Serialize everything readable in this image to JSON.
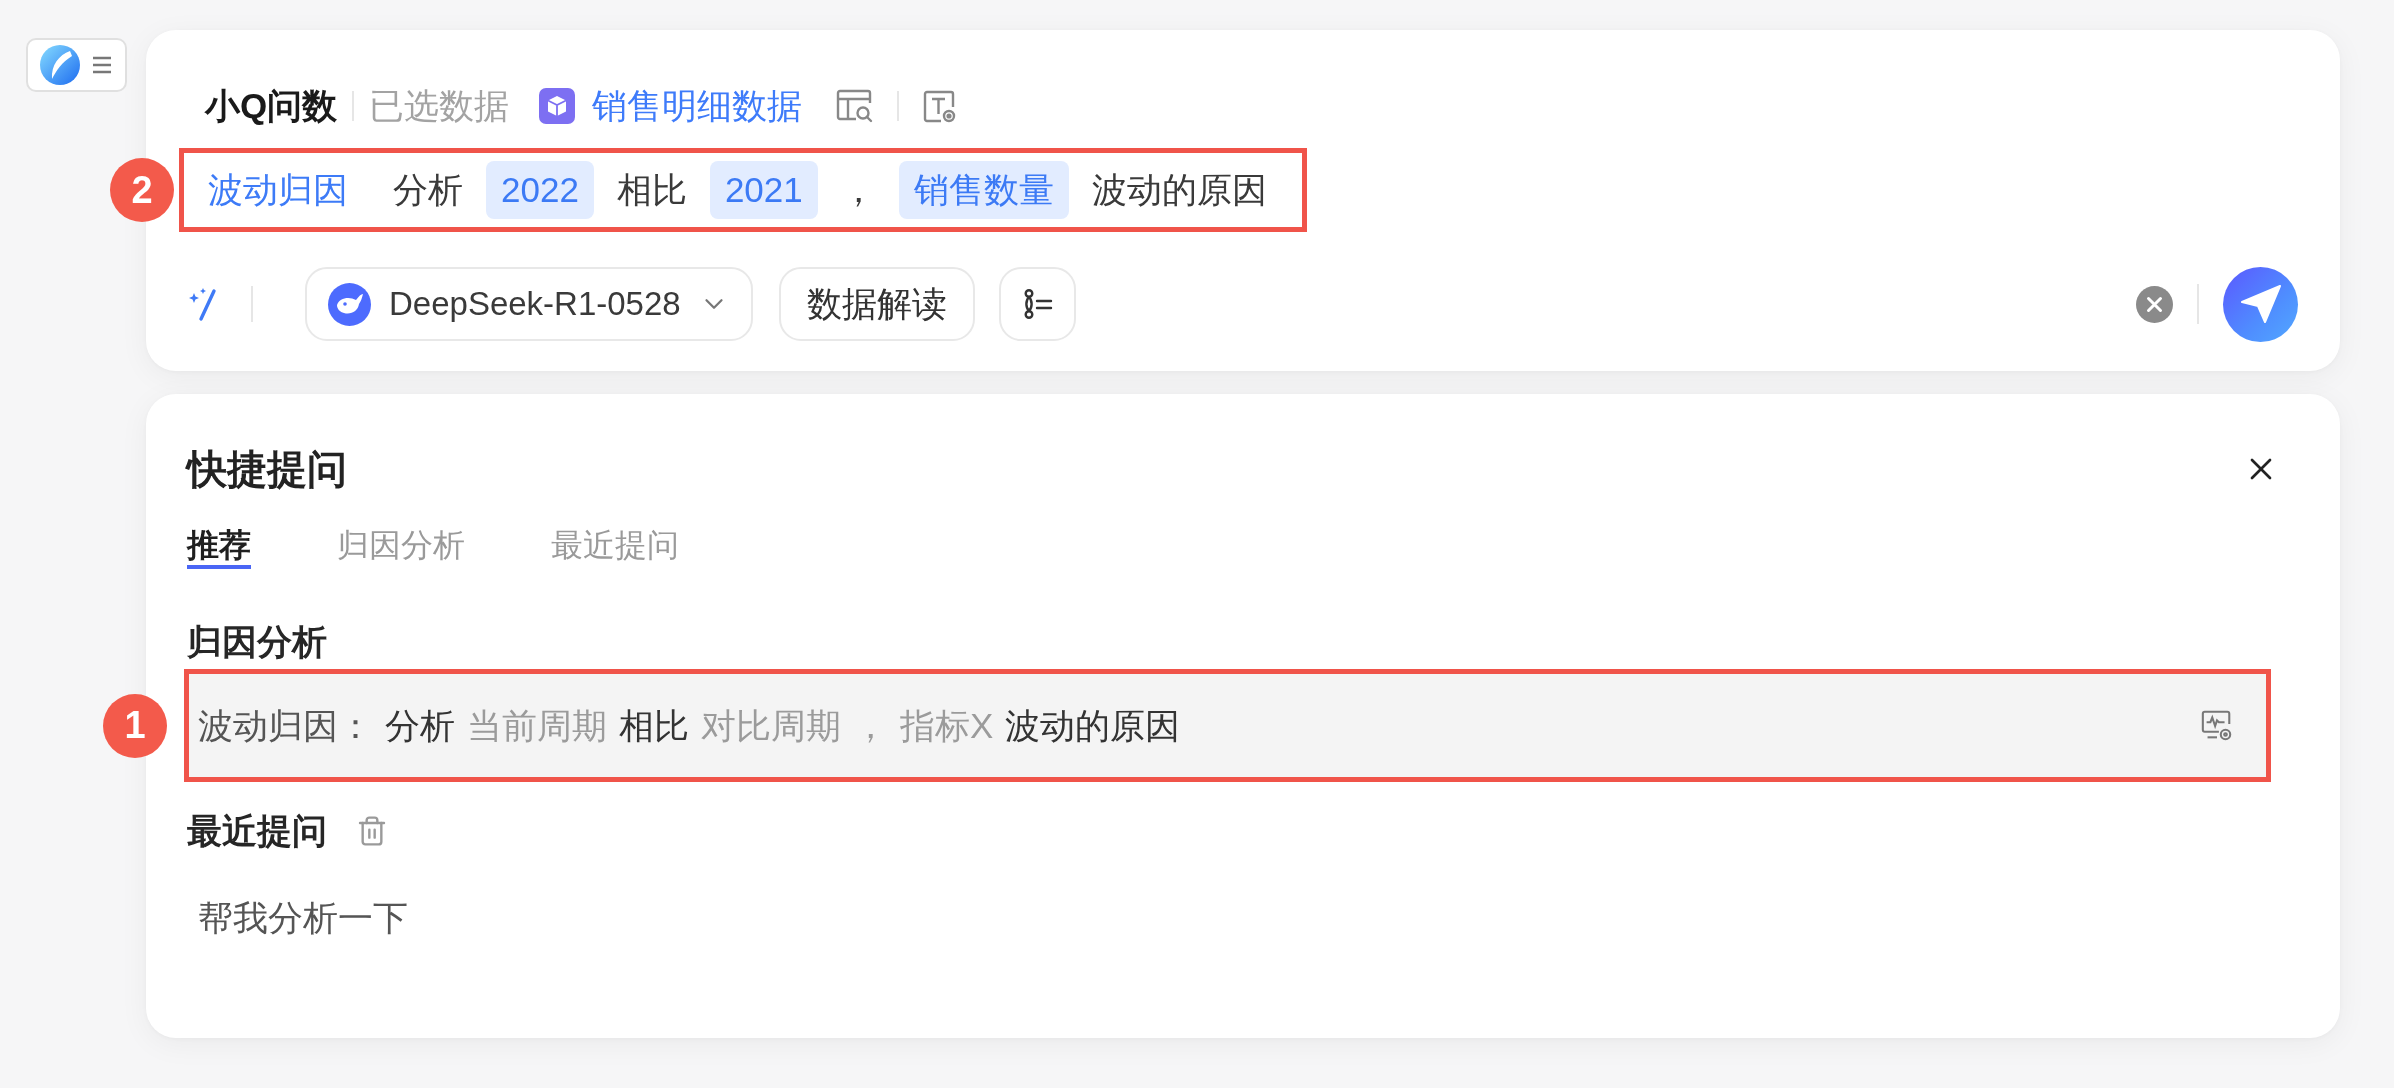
{
  "header": {
    "title": "小Q问数",
    "data_label": "已选数据",
    "dataset": "销售明细数据"
  },
  "query": {
    "badge": "2",
    "segments": [
      {
        "kind": "keyword",
        "text": "波动归因"
      },
      {
        "kind": "text",
        "text": "分析"
      },
      {
        "kind": "chip",
        "text": "2022"
      },
      {
        "kind": "text",
        "text": "相比"
      },
      {
        "kind": "chip",
        "text": "2021"
      },
      {
        "kind": "text",
        "text": "，"
      },
      {
        "kind": "chip",
        "text": "销售数量"
      },
      {
        "kind": "text",
        "text": "波动的原因"
      }
    ]
  },
  "toolbar": {
    "model": "DeepSeek-R1-0528",
    "button": "数据解读"
  },
  "quick_panel": {
    "title": "快捷提问",
    "tabs": [
      {
        "label": "推荐",
        "selected": true
      },
      {
        "label": "归因分析",
        "selected": false
      },
      {
        "label": "最近提问",
        "selected": false
      }
    ],
    "attribution": {
      "heading": "归因分析",
      "templates": [
        {
          "badge": "1",
          "segments": [
            {
              "kind": "label",
              "text": "波动归因："
            },
            {
              "kind": "text",
              "text": "分析"
            },
            {
              "kind": "slot",
              "text": "当前周期"
            },
            {
              "kind": "text",
              "text": "相比"
            },
            {
              "kind": "slot",
              "text": "对比周期"
            },
            {
              "kind": "slot",
              "text": "，"
            },
            {
              "kind": "slot",
              "text": "指标X"
            },
            {
              "kind": "text",
              "text": "波动的原因"
            }
          ]
        }
      ]
    },
    "recent": {
      "heading": "最近提问",
      "items": [
        "帮我分析一下"
      ]
    }
  }
}
